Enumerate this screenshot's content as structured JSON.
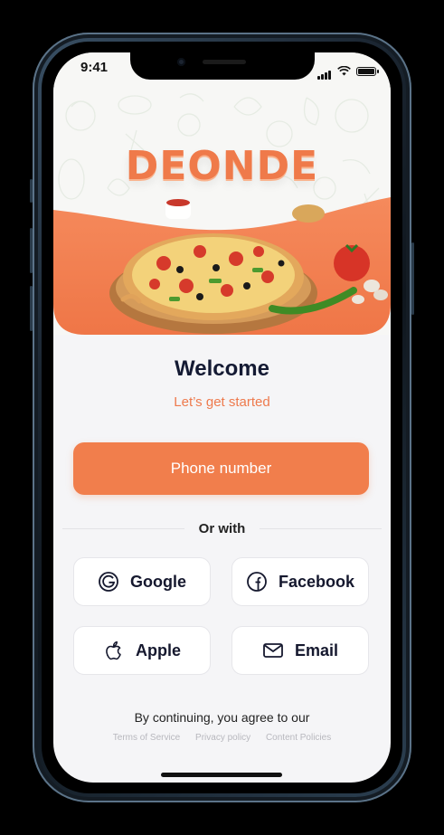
{
  "status": {
    "time": "9:41"
  },
  "hero": {
    "brand": "DEONDE"
  },
  "welcome": {
    "title": "Welcome",
    "subtitle": "Let’s get started"
  },
  "actions": {
    "phone_label": "Phone number",
    "or_with": "Or with"
  },
  "social": [
    {
      "label": "Google",
      "icon": "google-icon"
    },
    {
      "label": "Facebook",
      "icon": "facebook-icon"
    },
    {
      "label": "Apple",
      "icon": "apple-icon"
    },
    {
      "label": "Email",
      "icon": "email-icon"
    }
  ],
  "legal": {
    "notice": "By continuing, you agree to our",
    "links": [
      "Terms of Service",
      "Privacy policy",
      "Content Policies"
    ]
  },
  "colors": {
    "accent": "#f17e4c",
    "text_dark": "#141a33",
    "background": "#f5f5f7"
  }
}
